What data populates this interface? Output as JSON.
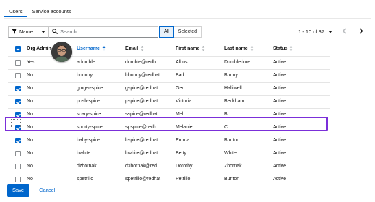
{
  "tabs": [
    {
      "label": "Users",
      "active": true
    },
    {
      "label": "Service accounts",
      "active": false
    }
  ],
  "toolbar": {
    "filter_label": "Name",
    "search_placeholder": "Search",
    "toggle_all": "All",
    "toggle_selected": "Selected",
    "pagination_range": "1 - 10 of 37"
  },
  "table": {
    "headers": {
      "org_admin": "Org Admin",
      "username": "Username",
      "email": "Email",
      "first_name": "First name",
      "last_name": "Last name",
      "status": "Status"
    },
    "rows": [
      {
        "checked": false,
        "org_admin": "Yes",
        "username": "adumble",
        "email": "dumble@redh...",
        "first_name": "Albus",
        "last_name": "Dumbledore",
        "status": "Active"
      },
      {
        "checked": false,
        "org_admin": "No",
        "username": "bbunny",
        "email": "bbunny@redhat...",
        "first_name": "Bad",
        "last_name": "Bunny",
        "status": "Active"
      },
      {
        "checked": true,
        "org_admin": "No",
        "username": "ginger-spice",
        "email": "gspice@redhat...",
        "first_name": "Geri",
        "last_name": "Halliwell",
        "status": "Active"
      },
      {
        "checked": true,
        "org_admin": "No",
        "username": "posh-spice",
        "email": "pspice@redhat...",
        "first_name": "Victoria",
        "last_name": "Beckham",
        "status": "Active"
      },
      {
        "checked": true,
        "org_admin": "No",
        "username": "scary-spice",
        "email": "sspice@redhat...",
        "first_name": "Mel",
        "last_name": "B",
        "status": "Active"
      },
      {
        "checked": true,
        "org_admin": "No",
        "username": "sporty-spice",
        "email": "spspice@redh...",
        "first_name": "Melanie",
        "last_name": "C",
        "status": "Active"
      },
      {
        "checked": true,
        "org_admin": "No",
        "username": "baby-spice",
        "email": "bspice@redhat...",
        "first_name": "Emma",
        "last_name": "Bunton",
        "status": "Active"
      },
      {
        "checked": false,
        "org_admin": "No",
        "username": "bwhite",
        "email": "bwhite@redhat...",
        "first_name": "Betty",
        "last_name": "White",
        "status": "Active"
      },
      {
        "checked": false,
        "org_admin": "No",
        "username": "dzbornak",
        "email": "dzbornak@red",
        "first_name": "Dorothy",
        "last_name": "Zbornak",
        "status": "Active"
      },
      {
        "checked": false,
        "org_admin": "No",
        "username": "spetrillo",
        "email": "spetrillo@redhat",
        "first_name": "Petrillo",
        "last_name": "Bunton",
        "status": "Active"
      }
    ]
  },
  "footer": {
    "save_label": "Save",
    "cancel_label": "Cancel"
  },
  "colors": {
    "primary": "#0066cc",
    "highlight": "#7b2fd9"
  },
  "icons": [
    "filter-icon",
    "caret-down-icon",
    "search-icon",
    "sort-up-icon",
    "sort-icon",
    "angle-left-icon",
    "angle-right-icon",
    "kebab-icon",
    "avatar"
  ]
}
